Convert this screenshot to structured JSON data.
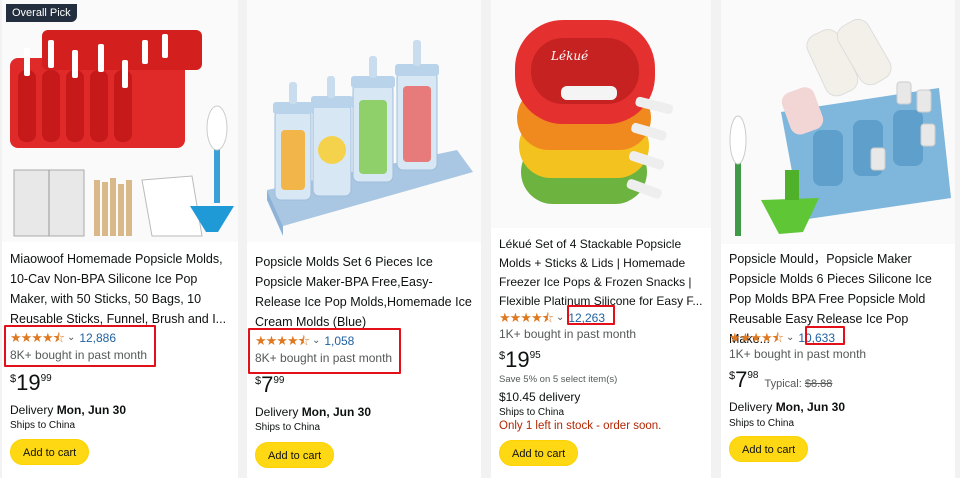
{
  "products": [
    {
      "badge": "Overall Pick",
      "title": "Miaowoof Homemade Popsicle Molds, 10-Cav Non-BPA Silicone Ice Pop Maker, with 50 Sticks, 50 Bags, 10 Reusable Sticks, Funnel, Brush and I...",
      "stars": "★★★★⯪",
      "rating_count": "12,886",
      "bought": "8K+ bought in past month",
      "price_symbol": "$",
      "price_whole": "19",
      "price_fraction": "99",
      "delivery_prefix": "Delivery ",
      "delivery_date": "Mon, Jun 30",
      "ships_to": "Ships to China",
      "add_to_cart": "Add to cart",
      "image_icon": "red-popsicle-mold-image",
      "accent": "#e02a2a"
    },
    {
      "title": "Popsicle Molds Set 6 Pieces Ice Popsicle Maker-BPA Free,Easy-Release Ice Pop Molds,Homemade Ice Cream Molds (Blue)",
      "stars": "★★★★⯪",
      "rating_count": "1,058",
      "bought": "8K+ bought in past month",
      "price_symbol": "$",
      "price_whole": "7",
      "price_fraction": "99",
      "delivery_prefix": "Delivery ",
      "delivery_date": "Mon, Jun 30",
      "ships_to": "Ships to China",
      "add_to_cart": "Add to cart",
      "image_icon": "blue-popsicle-molds-image",
      "accent": "#8fb8dd"
    },
    {
      "title": "Lékué Set of 4 Stackable Popsicle Molds + Sticks & Lids | Homemade Freezer Ice Pops & Frozen Snacks | Flexible Platinum Silicone for Easy F...",
      "stars": "★★★★⯪",
      "rating_count": "12,263",
      "bought": "1K+ bought in past month",
      "price_symbol": "$",
      "price_whole": "19",
      "price_fraction": "95",
      "save_text": "Save 5% on 5 select item(s)",
      "shipping_price": "$10.45 delivery",
      "ships_to": "Ships to China",
      "stock": "Only 1 left in stock - order soon.",
      "add_to_cart": "Add to cart",
      "image_icon": "stacked-colorful-molds-image",
      "accent": "#e53030"
    },
    {
      "title": "Popsicle Mould，Popsicle Maker Popsicle Molds 6 Pieces Silicone Ice Pop Molds BPA Free Popsicle Mold Reusable Easy Release Ice Pop Make...",
      "stars": "★★★★⯪",
      "rating_count": "10,633",
      "bought": "1K+ bought in past month",
      "price_symbol": "$",
      "price_whole": "7",
      "price_fraction": "98",
      "typical_label": "Typical: ",
      "typical_price": "$8.88",
      "delivery_prefix": "Delivery ",
      "delivery_date": "Mon, Jun 30",
      "ships_to": "Ships to China",
      "add_to_cart": "Add to cart",
      "image_icon": "blue-silicone-molds-image",
      "accent": "#7eb6dc"
    }
  ],
  "colors": {
    "star": "#de7921",
    "link": "#2162a1",
    "button": "#ffd814",
    "highlight": "#e3101a",
    "stock": "#b12704"
  }
}
